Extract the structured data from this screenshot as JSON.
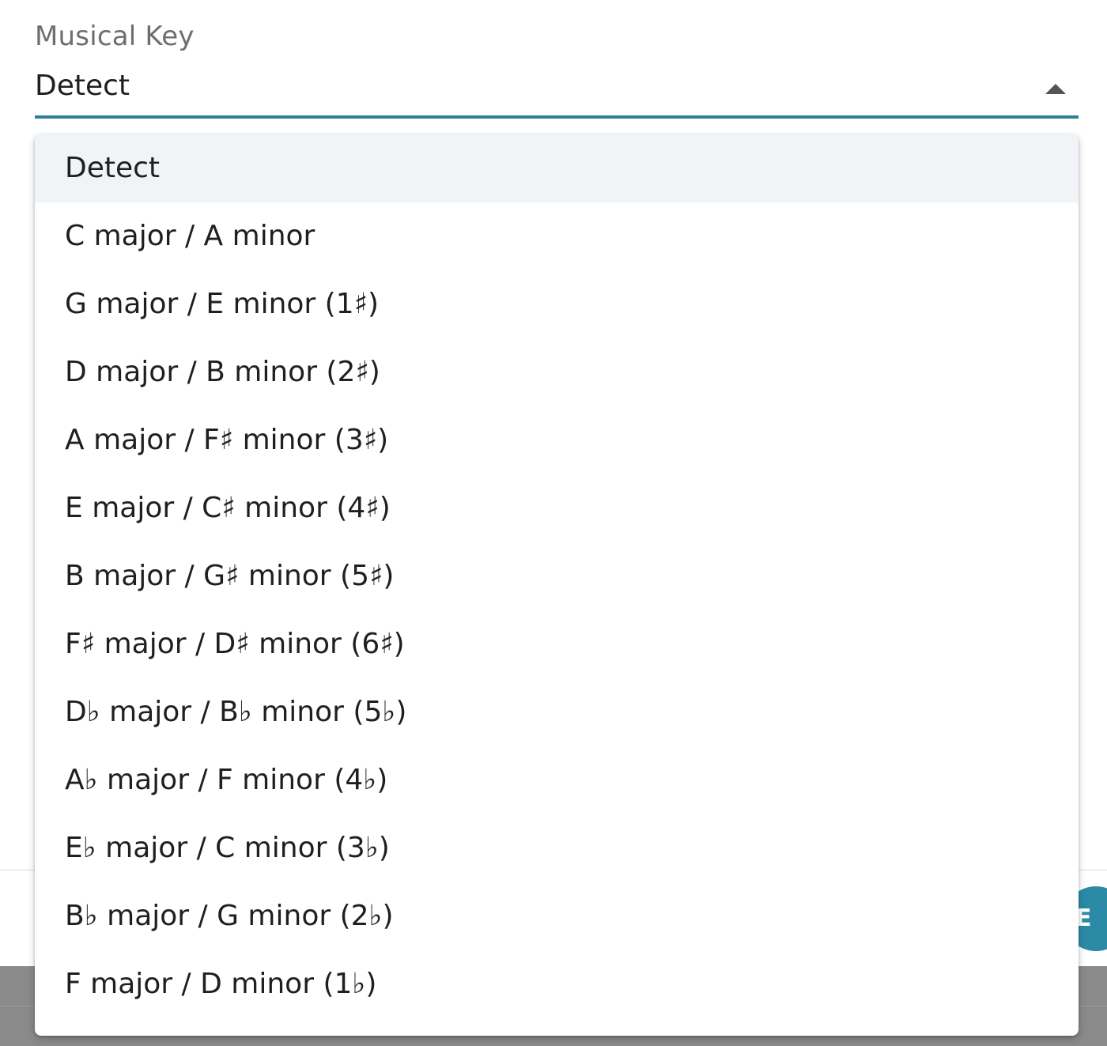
{
  "field": {
    "label": "Musical Key",
    "value": "Detect"
  },
  "menu": {
    "items": [
      {
        "label": "Detect",
        "selected": true
      },
      {
        "label": "C major / A minor"
      },
      {
        "label": "G major / E minor (1♯)"
      },
      {
        "label": "D major / B minor (2♯)"
      },
      {
        "label": "A major / F♯ minor (3♯)"
      },
      {
        "label": "E major / C♯ minor (4♯)"
      },
      {
        "label": "B major / G♯ minor (5♯)"
      },
      {
        "label": "F♯ major / D♯ minor (6♯)"
      },
      {
        "label": "D♭ major / B♭ minor (5♭)"
      },
      {
        "label": "A♭ major / F minor (4♭)"
      },
      {
        "label": "E♭ major / C minor (3♭)"
      },
      {
        "label": "B♭ major / G minor (2♭)"
      },
      {
        "label": "F major / D minor (1♭)"
      }
    ]
  },
  "background": {
    "action_button_label": "E"
  },
  "colors": {
    "accent": "#2b7f99",
    "selected_bg": "#f0f4f6",
    "action_button": "#2b8aa6"
  },
  "icons": {
    "dropdown_arrow": "arrow-up-icon"
  }
}
